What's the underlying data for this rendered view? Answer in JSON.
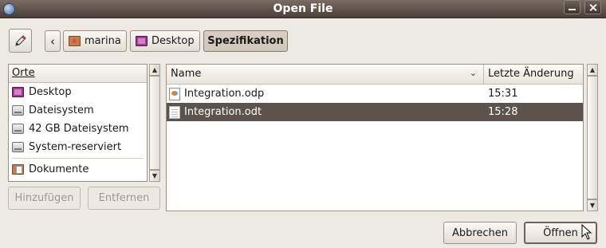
{
  "window": {
    "title": "Open File"
  },
  "pathbar": {
    "crumbs": [
      {
        "label": "marina",
        "icon": "home-folder-icon"
      },
      {
        "label": "Desktop",
        "icon": "desktop-icon"
      },
      {
        "label": "Spezifikation",
        "icon": ""
      }
    ],
    "active": "Spezifikation"
  },
  "places": {
    "header": "Orte",
    "items": [
      {
        "label": "Desktop",
        "icon": "desktop-icon"
      },
      {
        "label": "Dateisystem",
        "icon": "drive-icon"
      },
      {
        "label": "42 GB Dateisystem",
        "icon": "drive-icon"
      },
      {
        "label": "System-reserviert",
        "icon": "drive-icon"
      }
    ],
    "bookmarks": [
      {
        "label": "Dokumente",
        "icon": "documents-folder-icon"
      }
    ],
    "add_label": "Hinzufügen",
    "remove_label": "Entfernen"
  },
  "files": {
    "columns": {
      "name": "Name",
      "modified": "Letzte Änderung"
    },
    "rows": [
      {
        "name": "Integration.odp",
        "modified": "15:31",
        "icon": "presentation-file-icon",
        "selected": false
      },
      {
        "name": "Integration.odt",
        "modified": "15:28",
        "icon": "text-document-icon",
        "selected": true
      }
    ]
  },
  "actions": {
    "cancel_label": "Abbrechen",
    "open_label": "Öffnen"
  },
  "colors": {
    "titlebar": "#4a3f38",
    "selection": "#5c534c",
    "background": "#ede9e3"
  }
}
